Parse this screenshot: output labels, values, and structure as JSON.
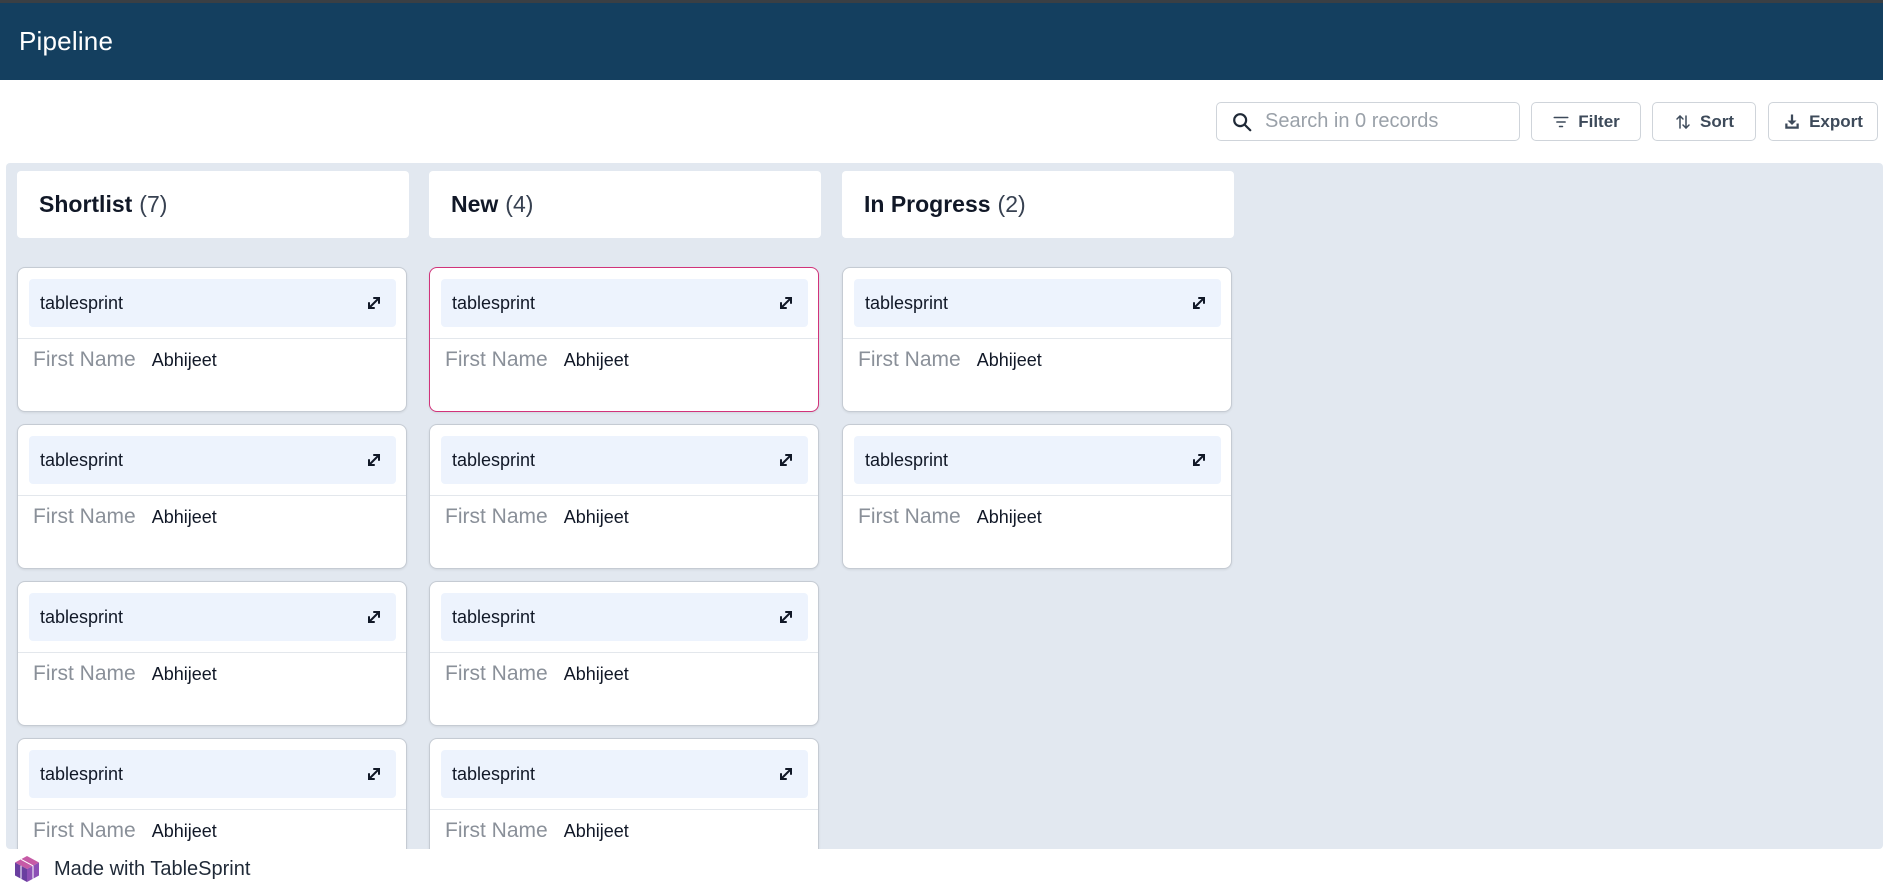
{
  "header": {
    "title": "Pipeline"
  },
  "toolbar": {
    "search_placeholder": "Search in 0 records",
    "filter_label": "Filter",
    "sort_label": "Sort",
    "export_label": "Export"
  },
  "columns": [
    {
      "name": "Shortlist",
      "count": "(7)",
      "cards": [
        {
          "title": "tablesprint",
          "field_label": "First Name",
          "field_value": "Abhijeet"
        },
        {
          "title": "tablesprint",
          "field_label": "First Name",
          "field_value": "Abhijeet"
        },
        {
          "title": "tablesprint",
          "field_label": "First Name",
          "field_value": "Abhijeet"
        },
        {
          "title": "tablesprint",
          "field_label": "First Name",
          "field_value": "Abhijeet"
        }
      ]
    },
    {
      "name": "New",
      "count": "(4)",
      "cards": [
        {
          "title": "tablesprint",
          "field_label": "First Name",
          "field_value": "Abhijeet"
        },
        {
          "title": "tablesprint",
          "field_label": "First Name",
          "field_value": "Abhijeet"
        },
        {
          "title": "tablesprint",
          "field_label": "First Name",
          "field_value": "Abhijeet"
        },
        {
          "title": "tablesprint",
          "field_label": "First Name",
          "field_value": "Abhijeet"
        }
      ]
    },
    {
      "name": "In Progress",
      "count": "(2)",
      "cards": [
        {
          "title": "tablesprint",
          "field_label": "First Name",
          "field_value": "Abhijeet"
        },
        {
          "title": "tablesprint",
          "field_label": "First Name",
          "field_value": "Abhijeet"
        }
      ]
    }
  ],
  "footer": {
    "brand_text": "Made with TableSprint"
  },
  "icons": {
    "search": "search-icon",
    "filter": "filter-icon",
    "sort": "sort-icon",
    "export": "download-icon",
    "expand": "expand-icon",
    "brand": "tablesprint-logo-icon"
  },
  "colors": {
    "header_bg": "#143f5f",
    "board_bg": "#e2e8f0",
    "card_header_bg": "#edf3fd",
    "selected_border": "#d1337a"
  }
}
